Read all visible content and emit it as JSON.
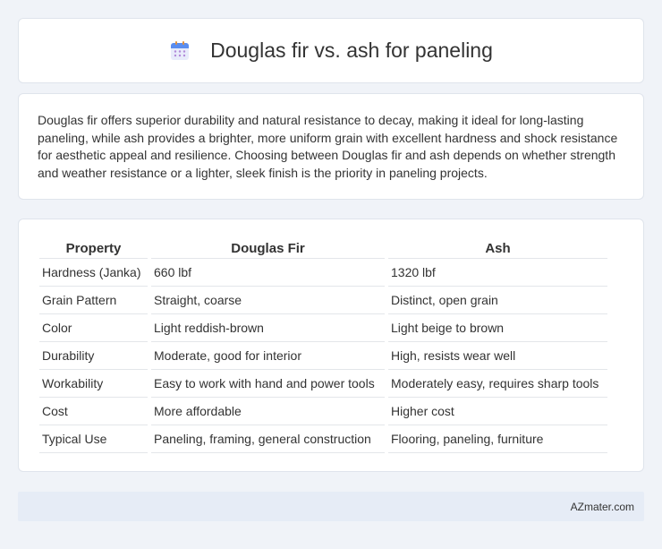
{
  "header": {
    "title": "Douglas fir vs. ash for paneling",
    "icon": "calendar-icon"
  },
  "intro": {
    "text": "Douglas fir offers superior durability and natural resistance to decay, making it ideal for long-lasting paneling, while ash provides a brighter, more uniform grain with excellent hardness and shock resistance for aesthetic appeal and resilience. Choosing between Douglas fir and ash depends on whether strength and weather resistance or a lighter, sleek finish is the priority in paneling projects."
  },
  "table": {
    "headers": [
      "Property",
      "Douglas Fir",
      "Ash"
    ],
    "rows": [
      [
        "Hardness (Janka)",
        "660 lbf",
        "1320 lbf"
      ],
      [
        "Grain Pattern",
        "Straight, coarse",
        "Distinct, open grain"
      ],
      [
        "Color",
        "Light reddish-brown",
        "Light beige to brown"
      ],
      [
        "Durability",
        "Moderate, good for interior",
        "High, resists wear well"
      ],
      [
        "Workability",
        "Easy to work with hand and power tools",
        "Moderately easy, requires sharp tools"
      ],
      [
        "Cost",
        "More affordable",
        "Higher cost"
      ],
      [
        "Typical Use",
        "Paneling, framing, general construction",
        "Flooring, paneling, furniture"
      ]
    ]
  },
  "footer": {
    "brand": "AZmater.com"
  }
}
